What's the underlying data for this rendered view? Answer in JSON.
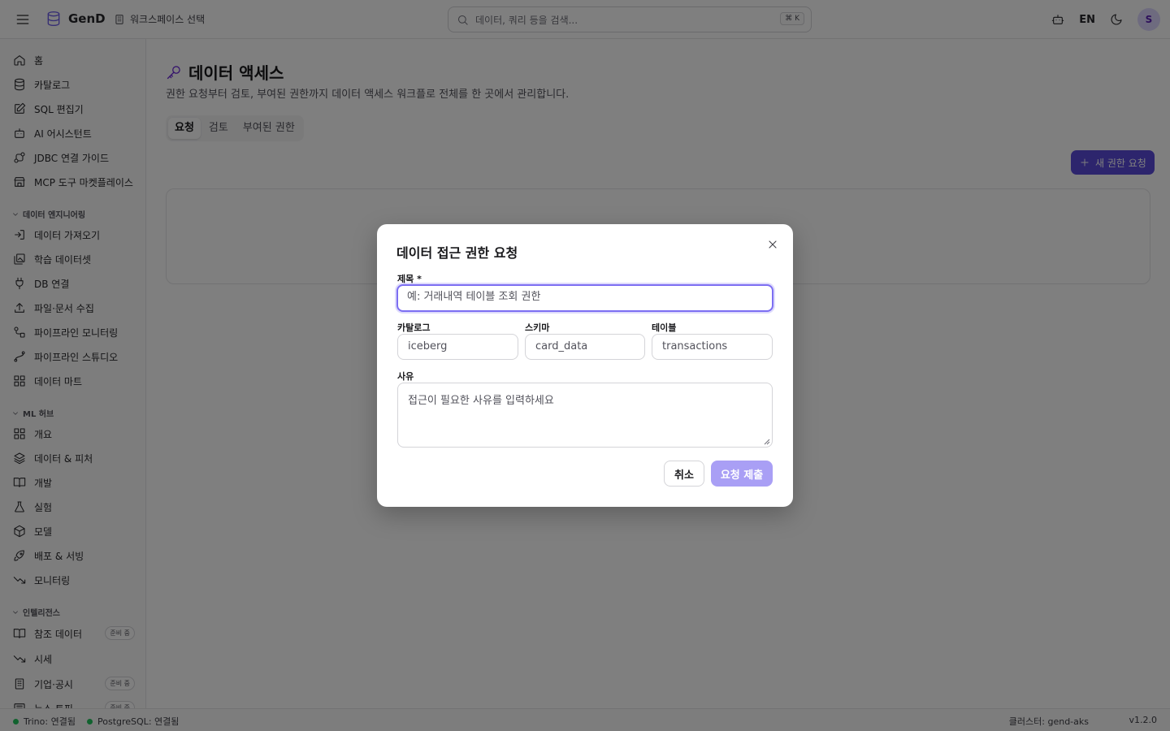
{
  "header": {
    "app_name": "GenD",
    "workspace_label": "워크스페이스 선택",
    "search_placeholder": "데이터, 쿼리 등을 검색...",
    "search_shortcut": "⌘ K",
    "lang": "EN",
    "avatar_initial": "S"
  },
  "sidebar": {
    "main_items": [
      "홈",
      "카탈로그",
      "SQL 편집기",
      "AI 어시스턴트",
      "JDBC 연결 가이드",
      "MCP 도구 마켓플레이스"
    ],
    "sections": [
      {
        "title": "데이터 엔지니어링",
        "items": [
          "데이터 가져오기",
          "학습 데이터셋",
          "DB 연결",
          "파일·문서 수집",
          "파이프라인 모니터링",
          "파이프라인 스튜디오",
          "데이터 마트"
        ]
      },
      {
        "title": "ML 허브",
        "items": [
          "개요",
          "데이터 & 피처",
          "개발",
          "실험",
          "모델",
          "배포 & 서빙",
          "모니터링"
        ]
      },
      {
        "title": "인텔리전스",
        "items": [
          "참조 데이터",
          "시세",
          "기업·공시",
          "뉴스 토픽"
        ],
        "badge": "준비 중"
      }
    ]
  },
  "page": {
    "title": "데이터 액세스",
    "description": "권한 요청부터 검토, 부여된 권한까지 데이터 액세스 워크플로 전체를 한 곳에서 관리합니다.",
    "tabs": [
      "요청",
      "검토",
      "부여된 권한"
    ],
    "new_request_button": "새 권한 요청"
  },
  "dialog": {
    "title": "데이터 접근 권한 요청",
    "subject_label": "제목 *",
    "subject_placeholder": "예: 거래내역 테이블 조회 권한",
    "catalog_label": "카탈로그",
    "catalog_value": "iceberg",
    "schema_label": "스키마",
    "schema_value": "card_data",
    "table_label": "테이블",
    "table_value": "transactions",
    "reason_label": "사유",
    "reason_placeholder": "접근이 필요한 사유를 입력하세요",
    "cancel_button": "취소",
    "submit_button": "요청 제출"
  },
  "statusbar": {
    "trino": "Trino: 연결됨",
    "postgres": "PostgreSQL: 연결됨",
    "cluster": "클러스터: gend-aks",
    "version": "v1.2.0"
  },
  "colors": {
    "accent": "#5b4bdb",
    "accent_disabled": "#a99ff5",
    "status_ok": "#22c55e"
  }
}
